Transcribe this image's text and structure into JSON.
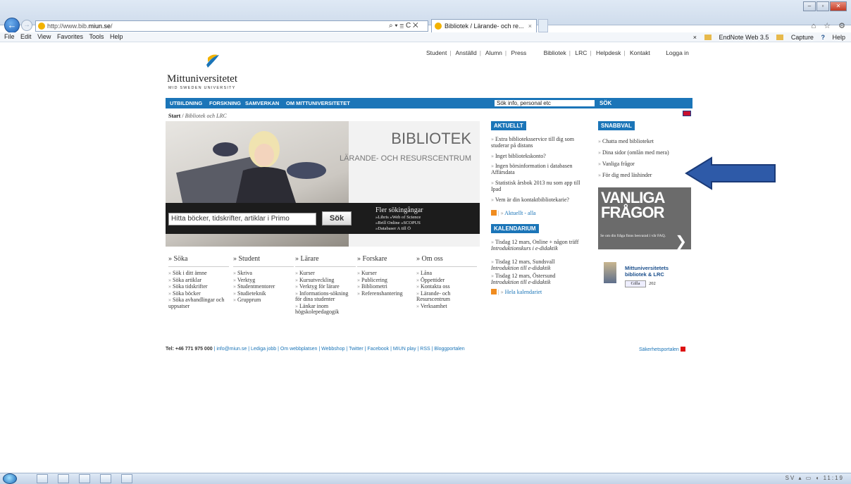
{
  "browser": {
    "url_prefix": "http://www.bib.",
    "url_domain": "miun.se",
    "url_suffix": "/",
    "addr_tools": "⌕ ▾ ≣ C ✕",
    "tab_title": "Bibliotek / Lärande- och re...",
    "tab_close": "×",
    "window_buttons": [
      "–",
      "▫",
      "✕"
    ],
    "right_icons": "⌂ ☆ ⚙",
    "menu": [
      "File",
      "Edit",
      "View",
      "Favorites",
      "Tools",
      "Help"
    ],
    "favorites": {
      "close": "×",
      "items": [
        "EndNote Web 3.5",
        "Capture",
        "Help"
      ],
      "help_mark": "?"
    }
  },
  "site": {
    "logo_name": "Mittuniversitetet",
    "logo_sub": "MID SWEDEN UNIVERSITY",
    "toplinks": [
      "Student",
      "Anställd",
      "Alumn",
      "Press",
      "Bibliotek",
      "LRC",
      "Helpdesk",
      "Kontakt",
      "Logga in"
    ],
    "nav": [
      "UTBILDNING",
      "FORSKNING",
      "SAMVERKAN",
      "OM MITTUNIVERSITETET"
    ],
    "search_placeholder": "Sök info, personal etc",
    "search_button": "SÖK",
    "breadcrumb_start": "Start",
    "breadcrumb_current": "Bibliotek och LRC",
    "hero": {
      "title": "BIBLIOTEK",
      "subtitle": "LÄRANDE- OCH RESURSCENTRUM",
      "primo_placeholder": "Hitta böcker, tidskrifter, artiklar i Primo",
      "primo_button": "Sök",
      "fler_title": "Fler sökingångar",
      "fler_lines": [
        "»Libris  »Web of Science",
        "»Brill Online  »SCOPUS",
        "»Databaser A till Ö"
      ]
    },
    "columns": [
      {
        "head": "Söka",
        "links": [
          "Sök i ditt ämne",
          "Söka artiklar",
          "Söka tidskrifter",
          "Söka böcker",
          "Söka avhandlingar och uppsatser"
        ]
      },
      {
        "head": "Student",
        "links": [
          "Skriva",
          "Verktyg",
          "Studentmentorer",
          "Studieteknik",
          "Grupprum"
        ]
      },
      {
        "head": "Lärare",
        "links": [
          "Kurser",
          "Kursutveckling",
          "Verktyg för lärare",
          "Informations-sökning för dina studenter",
          "Länkar inom högskolepedagogik"
        ]
      },
      {
        "head": "Forskare",
        "links": [
          "Kurser",
          "Publicering",
          "Bibliometri",
          "Referenshantering"
        ]
      },
      {
        "head": "Om oss",
        "links": [
          "Låna",
          "Öppettider",
          "Kontakta oss",
          "Lärande- och Resurscentrum",
          "Verksamhet"
        ]
      }
    ],
    "aktuellt": {
      "title": "AKTUELLT",
      "items": [
        "Extra biblioteksservice till dig som studerar på distans",
        "Inget bibliotekskonto?",
        "Ingen börsinformation i databasen Affärsdata",
        "Statistisk årsbok 2013 nu som app till Ipad",
        "Vem är din kontaktbibliotekarie?"
      ],
      "more": "Aktuellt - alla"
    },
    "kalendarium": {
      "title": "KALENDARIUM",
      "items": [
        {
          "date": "Tisdag 12 mars, Online + någon träff",
          "desc": "Introduktionskurs i e-didaktik"
        },
        {
          "date": "Tisdag 12 mars, Sundsvall",
          "desc": "Introduktion till e-didaktik"
        },
        {
          "date": "Tisdag 12 mars, Östersund",
          "desc": "Introduktion till e-didaktik"
        }
      ],
      "more": "Hela kalendariet"
    },
    "snabbval": {
      "title": "SNABBVAL",
      "items": [
        "Chatta med biblioteket",
        "Dina sidor (omlån med mera)",
        "Vanliga frågor",
        "För dig med läshinder"
      ]
    },
    "faq": {
      "line1": "VANLIGA",
      "line2": "FRÅGOR",
      "small": "Se om din fråga finns besvarad i vår FAQ."
    },
    "facebook": {
      "title": "Mittuniversitetets bibliotek & LRC",
      "like": "Gilla",
      "count": "202"
    },
    "footer": {
      "tel": "Tel: +46 771 975 000",
      "links": [
        "info@miun.se",
        "Lediga jobb",
        "Om webbplatsen",
        "Webbshop",
        "Twitter",
        "Facebook",
        "MIUN play",
        "RSS",
        "Bloggportalen"
      ],
      "sak": "Säkerhetsportalen"
    }
  },
  "taskbar": {
    "tray": "SV ▴ ▭ ◖ 11:19"
  },
  "colors": {
    "brand_blue": "#1b75b8",
    "arrow_blue": "#2e5aa8"
  }
}
